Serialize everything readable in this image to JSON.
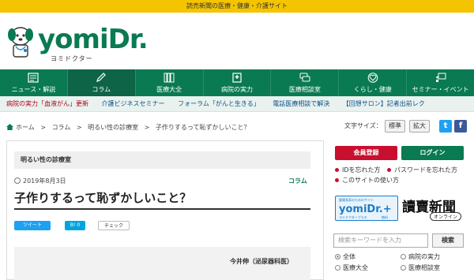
{
  "top_banner": "読売新聞の医療・健康・介護サイト",
  "logo": {
    "wordmark": "yomiDr.",
    "subtitle": "ヨミドクター"
  },
  "nav": [
    {
      "label": "ニュース・解説",
      "icon": "newspaper-icon"
    },
    {
      "label": "コラム",
      "icon": "pen-icon",
      "active": true
    },
    {
      "label": "医療大全",
      "icon": "book-icon"
    },
    {
      "label": "病院の実力",
      "icon": "hospital-icon"
    },
    {
      "label": "医療相談室",
      "icon": "chat-icon"
    },
    {
      "label": "くらし・健康",
      "icon": "heart-icon"
    },
    {
      "label": "セミナー・イベント",
      "icon": "presentation-icon"
    }
  ],
  "ticker": [
    "病院の実力「血液がん」更新",
    "介護ビジネスセミナー",
    "フォーラム「がんと生きる」",
    "電話医療相談で解決",
    "【回想サロン】記者出前レク"
  ],
  "breadcrumb": [
    "ホーム",
    "コラム",
    "明るい性の診療室",
    "子作りするって恥ずかしいこと？"
  ],
  "text_size": {
    "label": "文字サイズ：",
    "normal": "標準",
    "large": "拡大"
  },
  "social": {
    "twitter": "t",
    "facebook": "f"
  },
  "article": {
    "category": "明るい性の診療室",
    "date": "2019年8月3日",
    "column_label": "コラム",
    "title": "子作りするって恥ずかしいこと？",
    "share": {
      "tweet": "ツイート",
      "hatena": "B!",
      "hatena_count": "0",
      "check": "チェック"
    },
    "author": "今井伸（泌尿器科医）"
  },
  "sidebar": {
    "register": "会員登録",
    "login": "ログイン",
    "links": [
      "IDを忘れた方",
      "パスワードを忘れた方",
      "このサイトの使い方"
    ],
    "plus": {
      "small": "健康長寿のためのサイト",
      "wordmark": "yomiDr.+",
      "tag": "ヨミドクタープラス",
      "badge": "無料"
    },
    "yomiuri": {
      "name": "讀賣新聞",
      "online": "オンライン"
    },
    "search_placeholder": "検索キーワードを入力",
    "search_button": "検索",
    "radios": [
      {
        "label": "全体",
        "checked": true
      },
      {
        "label": "病院の実力",
        "checked": false
      },
      {
        "label": "医療大全",
        "checked": false
      },
      {
        "label": "医療相談室",
        "checked": false
      }
    ]
  },
  "colors": {
    "brand_green": "#0a7a52",
    "banner_yellow": "#f5c400",
    "register_red": "#c8102e",
    "twitter_blue": "#1da1f2",
    "facebook_blue": "#3b5998"
  }
}
